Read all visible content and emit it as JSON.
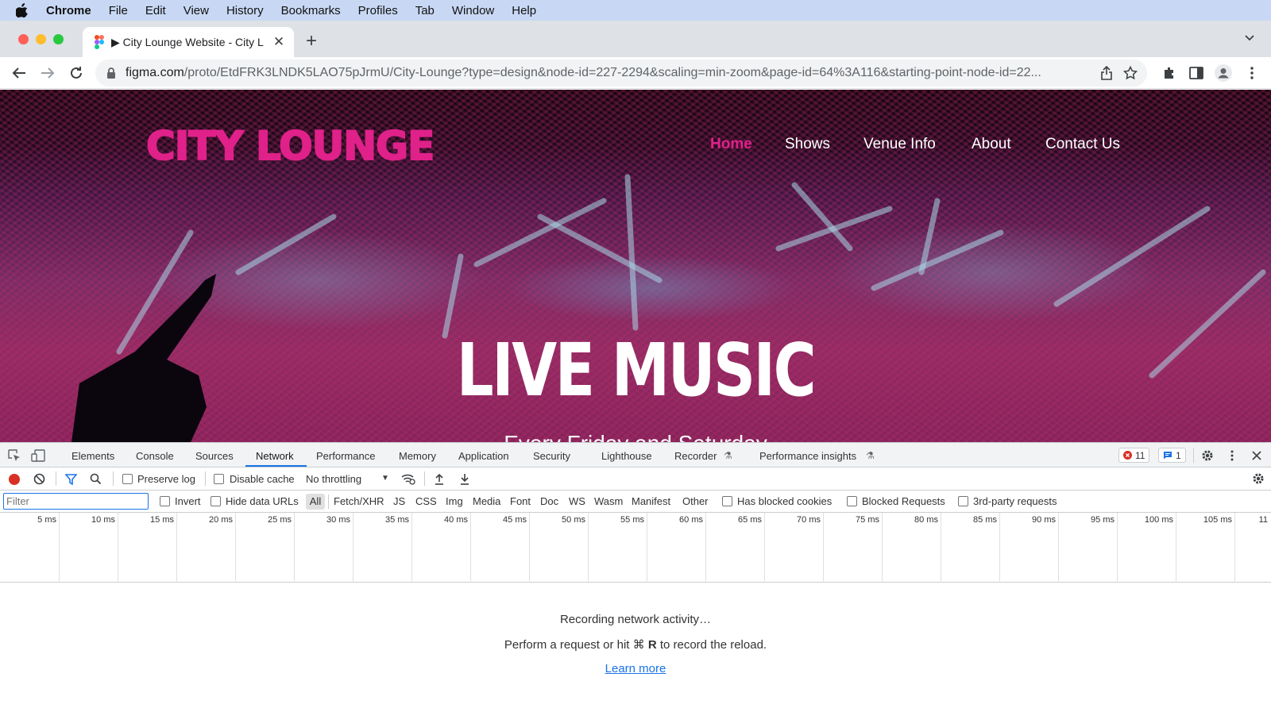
{
  "menubar": {
    "items": [
      "Chrome",
      "File",
      "Edit",
      "View",
      "History",
      "Bookmarks",
      "Profiles",
      "Tab",
      "Window",
      "Help"
    ]
  },
  "browser": {
    "tab_title": "▶ City Lounge Website - City L",
    "url_host": "figma.com",
    "url_path": "/proto/EtdFRK3LNDK5LAO75pJrmU/City-Lounge?type=design&node-id=227-2294&scaling=min-zoom&page-id=64%3A116&starting-point-node-id=22..."
  },
  "site": {
    "logo": "CITY LOUNGE",
    "nav": [
      {
        "label": "Home",
        "active": true
      },
      {
        "label": "Shows",
        "active": false
      },
      {
        "label": "Venue Info",
        "active": false
      },
      {
        "label": "About",
        "active": false
      },
      {
        "label": "Contact Us",
        "active": false
      }
    ],
    "hero_title": "LIVE MUSIC",
    "hero_subtitle": "Every Friday and Saturday"
  },
  "devtools": {
    "tabs": [
      "Elements",
      "Console",
      "Sources",
      "Network",
      "Performance",
      "Memory",
      "Application",
      "Security",
      "Lighthouse",
      "Recorder",
      "Performance insights"
    ],
    "active_tab": "Network",
    "error_count": "11",
    "message_count": "1",
    "preserve_log": "Preserve log",
    "disable_cache": "Disable cache",
    "throttling": "No throttling",
    "filter_placeholder": "Filter",
    "invert": "Invert",
    "hide_data_urls": "Hide data URLs",
    "type_filters": [
      "All",
      "Fetch/XHR",
      "JS",
      "CSS",
      "Img",
      "Media",
      "Font",
      "Doc",
      "WS",
      "Wasm",
      "Manifest",
      "Other"
    ],
    "has_blocked_cookies": "Has blocked cookies",
    "blocked_requests": "Blocked Requests",
    "third_party": "3rd-party requests",
    "timeline_ticks": [
      "5 ms",
      "10 ms",
      "15 ms",
      "20 ms",
      "25 ms",
      "30 ms",
      "35 ms",
      "40 ms",
      "45 ms",
      "50 ms",
      "55 ms",
      "60 ms",
      "65 ms",
      "70 ms",
      "75 ms",
      "80 ms",
      "85 ms",
      "90 ms",
      "95 ms",
      "100 ms",
      "105 ms",
      "11"
    ],
    "recording_text": "Recording network activity…",
    "hint_prefix": "Perform a request or hit ⌘",
    "hint_key": "R",
    "hint_suffix": "to record the reload.",
    "learn_more": "Learn more"
  },
  "colors": {
    "accent_pink": "#e0218a",
    "devtools_blue": "#1a73e8",
    "record_red": "#d93025"
  }
}
